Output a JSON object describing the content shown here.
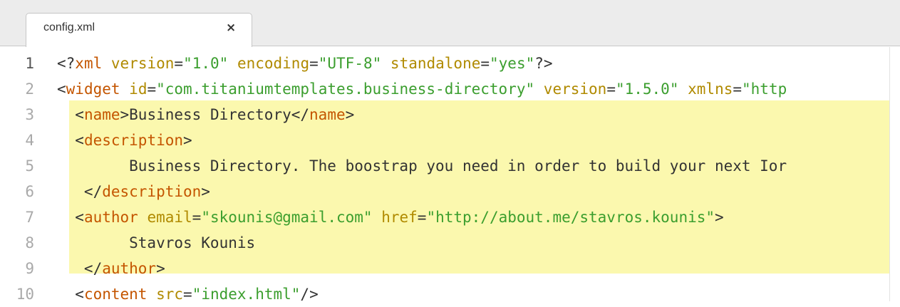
{
  "tab": {
    "title": "config.xml",
    "close_glyph": "×"
  },
  "colors": {
    "tag": "#c45500",
    "attribute": "#b08a00",
    "string": "#3b9e2e",
    "highlight": "#fbf8ae"
  },
  "lines": [
    {
      "number": "1",
      "active": true,
      "tokens": [
        {
          "c": "p",
          "t": "<?"
        },
        {
          "c": "t",
          "t": "xml"
        },
        {
          "c": "p",
          "t": " "
        },
        {
          "c": "a",
          "t": "version"
        },
        {
          "c": "p",
          "t": "="
        },
        {
          "c": "s",
          "t": "\"1.0\""
        },
        {
          "c": "p",
          "t": " "
        },
        {
          "c": "a",
          "t": "encoding"
        },
        {
          "c": "p",
          "t": "="
        },
        {
          "c": "s",
          "t": "\"UTF-8\""
        },
        {
          "c": "p",
          "t": " "
        },
        {
          "c": "a",
          "t": "standalone"
        },
        {
          "c": "p",
          "t": "="
        },
        {
          "c": "s",
          "t": "\"yes\""
        },
        {
          "c": "p",
          "t": "?>"
        }
      ]
    },
    {
      "number": "2",
      "active": false,
      "tokens": [
        {
          "c": "p",
          "t": "<"
        },
        {
          "c": "t",
          "t": "widget"
        },
        {
          "c": "p",
          "t": " "
        },
        {
          "c": "a",
          "t": "id"
        },
        {
          "c": "p",
          "t": "="
        },
        {
          "c": "s",
          "t": "\"com.titaniumtemplates.business-directory\""
        },
        {
          "c": "p",
          "t": " "
        },
        {
          "c": "a",
          "t": "version"
        },
        {
          "c": "p",
          "t": "="
        },
        {
          "c": "s",
          "t": "\"1.5.0\""
        },
        {
          "c": "p",
          "t": " "
        },
        {
          "c": "a",
          "t": "xmlns"
        },
        {
          "c": "p",
          "t": "="
        },
        {
          "c": "s",
          "t": "\"http"
        }
      ]
    },
    {
      "number": "3",
      "active": false,
      "tokens": [
        {
          "c": "p",
          "t": "  <"
        },
        {
          "c": "t",
          "t": "name"
        },
        {
          "c": "p",
          "t": ">Business Directory</"
        },
        {
          "c": "t",
          "t": "name"
        },
        {
          "c": "p",
          "t": ">"
        }
      ]
    },
    {
      "number": "4",
      "active": false,
      "tokens": [
        {
          "c": "p",
          "t": "  <"
        },
        {
          "c": "t",
          "t": "description"
        },
        {
          "c": "p",
          "t": ">"
        }
      ]
    },
    {
      "number": "5",
      "active": false,
      "tokens": [
        {
          "c": "p",
          "t": "        Business Directory. The boostrap you need in order to build your next Ior"
        }
      ]
    },
    {
      "number": "6",
      "active": false,
      "tokens": [
        {
          "c": "p",
          "t": "   </"
        },
        {
          "c": "t",
          "t": "description"
        },
        {
          "c": "p",
          "t": ">"
        }
      ]
    },
    {
      "number": "7",
      "active": false,
      "tokens": [
        {
          "c": "p",
          "t": "  <"
        },
        {
          "c": "t",
          "t": "author"
        },
        {
          "c": "p",
          "t": " "
        },
        {
          "c": "a",
          "t": "email"
        },
        {
          "c": "p",
          "t": "="
        },
        {
          "c": "s",
          "t": "\"skounis@gmail.com\""
        },
        {
          "c": "p",
          "t": " "
        },
        {
          "c": "a",
          "t": "href"
        },
        {
          "c": "p",
          "t": "="
        },
        {
          "c": "s",
          "t": "\"http://about.me/stavros.kounis\""
        },
        {
          "c": "p",
          "t": ">"
        }
      ]
    },
    {
      "number": "8",
      "active": false,
      "tokens": [
        {
          "c": "p",
          "t": "        Stavros Kounis"
        }
      ]
    },
    {
      "number": "9",
      "active": false,
      "tokens": [
        {
          "c": "p",
          "t": "   </"
        },
        {
          "c": "t",
          "t": "author"
        },
        {
          "c": "p",
          "t": ">"
        }
      ]
    },
    {
      "number": "10",
      "active": false,
      "tokens": [
        {
          "c": "p",
          "t": "  <"
        },
        {
          "c": "t",
          "t": "content"
        },
        {
          "c": "p",
          "t": " "
        },
        {
          "c": "a",
          "t": "src"
        },
        {
          "c": "p",
          "t": "="
        },
        {
          "c": "s",
          "t": "\"index.html\""
        },
        {
          "c": "p",
          "t": "/>"
        }
      ]
    }
  ]
}
